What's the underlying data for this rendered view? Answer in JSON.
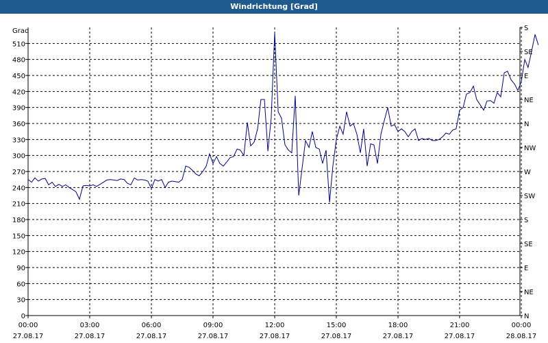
{
  "window": {
    "title": "Windrichtung [Grad]"
  },
  "colors": {
    "titlebar": "#1e5a8e",
    "line": "#00008b",
    "grid": "#000000"
  },
  "chart_data": {
    "type": "line",
    "title": "Windrichtung [Grad]",
    "ylabel": "Grad",
    "ylim": [
      0,
      540
    ],
    "yticks": [
      0,
      30,
      60,
      90,
      120,
      150,
      180,
      210,
      240,
      270,
      300,
      330,
      360,
      390,
      420,
      450,
      480,
      510
    ],
    "xlim_hours": [
      0,
      24
    ],
    "xticks": [
      {
        "hour": 0,
        "time": "00:00",
        "date": "27.08.17"
      },
      {
        "hour": 3,
        "time": "03:00",
        "date": "27.08.17"
      },
      {
        "hour": 6,
        "time": "06:00",
        "date": "27.08.17"
      },
      {
        "hour": 9,
        "time": "09:00",
        "date": "27.08.17"
      },
      {
        "hour": 12,
        "time": "12:00",
        "date": "27.08.17"
      },
      {
        "hour": 15,
        "time": "15:00",
        "date": "27.08.17"
      },
      {
        "hour": 18,
        "time": "18:00",
        "date": "27.08.17"
      },
      {
        "hour": 21,
        "time": "21:00",
        "date": "27.08.17"
      },
      {
        "hour": 24,
        "time": "00:00",
        "date": "28.08.17"
      }
    ],
    "right_axis": [
      {
        "value": 0,
        "label": "N"
      },
      {
        "value": 45,
        "label": "NE"
      },
      {
        "value": 90,
        "label": "E"
      },
      {
        "value": 135,
        "label": "SE"
      },
      {
        "value": 180,
        "label": "S"
      },
      {
        "value": 225,
        "label": "SW"
      },
      {
        "value": 270,
        "label": "W"
      },
      {
        "value": 315,
        "label": "NW"
      },
      {
        "value": 360,
        "label": "N"
      },
      {
        "value": 405,
        "label": "NE"
      },
      {
        "value": 450,
        "label": "E"
      },
      {
        "value": 495,
        "label": "SE"
      },
      {
        "value": 540,
        "label": "S"
      }
    ],
    "grid": true,
    "series": [
      {
        "points": [
          [
            0.0,
            255
          ],
          [
            0.17,
            250
          ],
          [
            0.33,
            258
          ],
          [
            0.5,
            252
          ],
          [
            0.67,
            256
          ],
          [
            0.83,
            257
          ],
          [
            1.0,
            245
          ],
          [
            1.17,
            250
          ],
          [
            1.33,
            242
          ],
          [
            1.5,
            246
          ],
          [
            1.67,
            242
          ],
          [
            1.83,
            245
          ],
          [
            2.0,
            240
          ],
          [
            2.17,
            236
          ],
          [
            2.33,
            232
          ],
          [
            2.5,
            218
          ],
          [
            2.67,
            243
          ],
          [
            2.83,
            244
          ],
          [
            3.0,
            243
          ],
          [
            3.17,
            245
          ],
          [
            3.33,
            242
          ],
          [
            3.5,
            246
          ],
          [
            3.67,
            250
          ],
          [
            3.83,
            254
          ],
          [
            4.0,
            255
          ],
          [
            4.17,
            254
          ],
          [
            4.33,
            253
          ],
          [
            4.5,
            256
          ],
          [
            4.67,
            255
          ],
          [
            4.83,
            248
          ],
          [
            5.0,
            245
          ],
          [
            5.17,
            258
          ],
          [
            5.33,
            254
          ],
          [
            5.5,
            255
          ],
          [
            5.67,
            254
          ],
          [
            5.83,
            252
          ],
          [
            6.0,
            238
          ],
          [
            6.17,
            255
          ],
          [
            6.33,
            252
          ],
          [
            6.5,
            255
          ],
          [
            6.67,
            240
          ],
          [
            6.83,
            250
          ],
          [
            7.0,
            252
          ],
          [
            7.17,
            251
          ],
          [
            7.33,
            250
          ],
          [
            7.5,
            255
          ],
          [
            7.67,
            280
          ],
          [
            7.83,
            278
          ],
          [
            8.0,
            272
          ],
          [
            8.17,
            265
          ],
          [
            8.33,
            262
          ],
          [
            8.5,
            270
          ],
          [
            8.67,
            280
          ],
          [
            8.83,
            303
          ],
          [
            9.0,
            285
          ],
          [
            9.17,
            298
          ],
          [
            9.33,
            285
          ],
          [
            9.5,
            280
          ],
          [
            9.67,
            288
          ],
          [
            9.83,
            296
          ],
          [
            10.0,
            298
          ],
          [
            10.17,
            312
          ],
          [
            10.33,
            310
          ],
          [
            10.5,
            300
          ],
          [
            10.67,
            362
          ],
          [
            10.83,
            318
          ],
          [
            11.0,
            325
          ],
          [
            11.17,
            350
          ],
          [
            11.33,
            405
          ],
          [
            11.5,
            405
          ],
          [
            11.67,
            308
          ],
          [
            11.83,
            370
          ],
          [
            12.0,
            530
          ],
          [
            12.17,
            382
          ],
          [
            12.33,
            370
          ],
          [
            12.5,
            320
          ],
          [
            12.67,
            310
          ],
          [
            12.83,
            305
          ],
          [
            13.0,
            412
          ],
          [
            13.17,
            225
          ],
          [
            13.33,
            275
          ],
          [
            13.5,
            328
          ],
          [
            13.67,
            315
          ],
          [
            13.83,
            345
          ],
          [
            14.0,
            315
          ],
          [
            14.17,
            312
          ],
          [
            14.33,
            285
          ],
          [
            14.5,
            310
          ],
          [
            14.67,
            212
          ],
          [
            14.83,
            280
          ],
          [
            15.0,
            330
          ],
          [
            15.17,
            355
          ],
          [
            15.33,
            340
          ],
          [
            15.5,
            382
          ],
          [
            15.67,
            355
          ],
          [
            15.83,
            360
          ],
          [
            16.0,
            340
          ],
          [
            16.17,
            305
          ],
          [
            16.33,
            350
          ],
          [
            16.5,
            280
          ],
          [
            16.67,
            322
          ],
          [
            16.83,
            320
          ],
          [
            17.0,
            285
          ],
          [
            17.17,
            340
          ],
          [
            17.33,
            365
          ],
          [
            17.5,
            390
          ],
          [
            17.67,
            355
          ],
          [
            17.83,
            358
          ],
          [
            18.0,
            345
          ],
          [
            18.17,
            350
          ],
          [
            18.33,
            345
          ],
          [
            18.5,
            335
          ],
          [
            18.67,
            345
          ],
          [
            18.83,
            350
          ],
          [
            19.0,
            328
          ],
          [
            19.17,
            332
          ],
          [
            19.33,
            330
          ],
          [
            19.5,
            332
          ],
          [
            19.67,
            328
          ],
          [
            19.83,
            328
          ],
          [
            20.0,
            330
          ],
          [
            20.17,
            335
          ],
          [
            20.33,
            342
          ],
          [
            20.5,
            340
          ],
          [
            20.67,
            348
          ],
          [
            20.83,
            350
          ],
          [
            21.0,
            385
          ],
          [
            21.17,
            390
          ],
          [
            21.33,
            415
          ],
          [
            21.5,
            418
          ],
          [
            21.67,
            430
          ],
          [
            21.83,
            405
          ],
          [
            22.0,
            395
          ],
          [
            22.17,
            385
          ],
          [
            22.33,
            402
          ],
          [
            22.5,
            403
          ],
          [
            22.67,
            398
          ],
          [
            22.83,
            418
          ],
          [
            23.0,
            410
          ],
          [
            23.17,
            455
          ],
          [
            23.33,
            458
          ],
          [
            23.5,
            442
          ],
          [
            23.67,
            434
          ],
          [
            23.83,
            422
          ],
          [
            24.0,
            438
          ],
          [
            24.17,
            480
          ],
          [
            24.33,
            465
          ],
          [
            24.5,
            495
          ],
          [
            24.67,
            527
          ],
          [
            24.83,
            507
          ]
        ]
      }
    ]
  }
}
